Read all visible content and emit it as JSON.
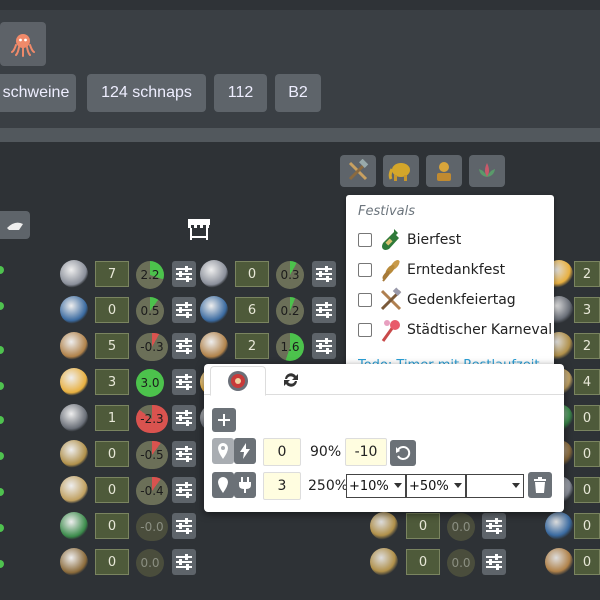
{
  "header": {
    "tags": [
      "schweine",
      "124 schnaps",
      "112",
      "B2"
    ]
  },
  "columns": {
    "col1": [
      {
        "value": "7",
        "pie": "2.2",
        "pie_color": "#4cc24c",
        "pie_fill": 0.3
      },
      {
        "value": "0",
        "pie": "0.5",
        "pie_color": "#4cc24c",
        "pie_fill": 0.1
      },
      {
        "value": "5",
        "pie": "-0.3",
        "pie_color": "#d9534f",
        "pie_fill": 0.08
      },
      {
        "value": "3",
        "pie": "3.0",
        "pie_color": "#4cc24c",
        "pie_fill": 1.0
      },
      {
        "value": "1",
        "pie": "-2.3",
        "pie_color": "#d9534f",
        "pie_fill": 0.85
      },
      {
        "value": "0",
        "pie": "-0.5",
        "pie_color": "#d9534f",
        "pie_fill": 0.1
      },
      {
        "value": "0",
        "pie": "-0.4",
        "pie_color": "#d9534f",
        "pie_fill": 0.1
      },
      {
        "value": "0",
        "pie": "-0.0",
        "pie_color": "#4a4d3c",
        "pie_fill": 0
      },
      {
        "value": "0",
        "pie": "0.0",
        "pie_color": "#4a4d3c",
        "pie_fill": 0
      }
    ],
    "col2": [
      {
        "value": "0",
        "pie": "0.3",
        "pie_color": "#4cc24c",
        "pie_fill": 0.08
      },
      {
        "value": "6",
        "pie": "0.2",
        "pie_color": "#4cc24c",
        "pie_fill": 0.06
      },
      {
        "value": "2",
        "pie": "1.6",
        "pie_color": "#4cc24c",
        "pie_fill": 0.55
      },
      {
        "value": "0",
        "pie": "-0.0",
        "pie_color": "#4a4d3c",
        "pie_fill": 0
      },
      {
        "value": "0",
        "pie": "-0.0",
        "pie_color": "#4a4d3c",
        "pie_fill": 0
      }
    ],
    "col3": [
      {
        "value": "0",
        "pie": "0.0",
        "pie_color": "#4a4d3c",
        "pie_fill": 0
      },
      {
        "value": "0",
        "pie": "0.0",
        "pie_color": "#4a4d3c",
        "pie_fill": 0
      }
    ],
    "col4": [
      "2",
      "3",
      "2",
      "4",
      "0",
      "0",
      "0",
      "0",
      "0"
    ]
  },
  "festivals": {
    "header": "Festivals",
    "items": [
      {
        "label": "Bierfest",
        "icon": "beer-bottle-icon"
      },
      {
        "label": "Erntedankfest",
        "icon": "wheat-icon"
      },
      {
        "label": "Gedenkfeiertag",
        "icon": "crossed-tools-icon"
      },
      {
        "label": "Städtischer Karneval",
        "icon": "fireworks-icon"
      }
    ],
    "todo_text": "Todo: Timer mit Restlaufzeit"
  },
  "popup": {
    "row1": {
      "value": "0",
      "percent": "90%",
      "offset": "-10"
    },
    "row2": {
      "value": "3",
      "percent": "250%",
      "select1": "+10%",
      "select2": "+50%",
      "select3": ""
    }
  }
}
